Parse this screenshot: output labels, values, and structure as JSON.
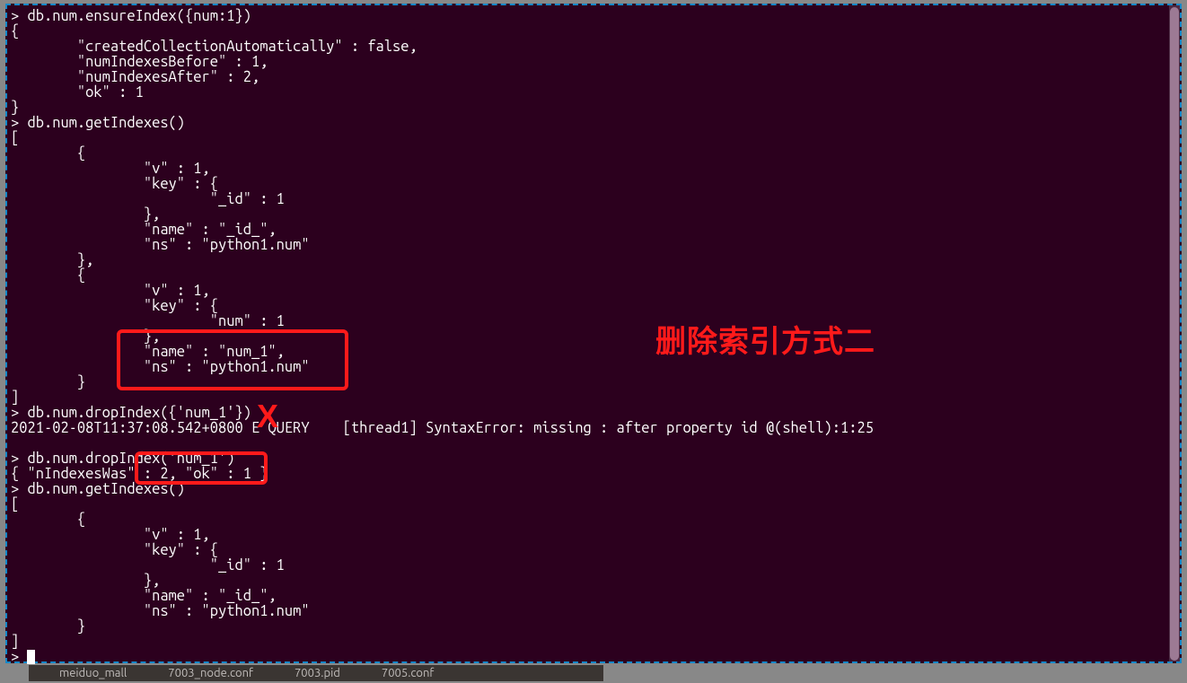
{
  "terminal": {
    "lines": [
      "> db.num.ensureIndex({num:1})",
      "{",
      "        \"createdCollectionAutomatically\" : false,",
      "        \"numIndexesBefore\" : 1,",
      "        \"numIndexesAfter\" : 2,",
      "        \"ok\" : 1",
      "}",
      "> db.num.getIndexes()",
      "[",
      "        {",
      "                \"v\" : 1,",
      "                \"key\" : {",
      "                        \"_id\" : 1",
      "                },",
      "                \"name\" : \"_id_\",",
      "                \"ns\" : \"python1.num\"",
      "        },",
      "        {",
      "                \"v\" : 1,",
      "                \"key\" : {",
      "                        \"num\" : 1",
      "                },",
      "                \"name\" : \"num_1\",",
      "                \"ns\" : \"python1.num\"",
      "        }",
      "]",
      "> db.num.dropIndex({'num_1'})",
      "2021-02-08T11:37:08.542+0800 E QUERY    [thread1] SyntaxError: missing : after property id @(shell):1:25",
      "",
      "> db.num.dropIndex('num_1')",
      "{ \"nIndexesWas\" : 2, \"ok\" : 1 }",
      "> db.num.getIndexes()",
      "[",
      "        {",
      "                \"v\" : 1,",
      "                \"key\" : {",
      "                        \"_id\" : 1",
      "                },",
      "                \"name\" : \"_id_\",",
      "                \"ns\" : \"python1.num\"",
      "        }",
      "]",
      "> "
    ]
  },
  "annotations": {
    "x_mark": "X",
    "big_label": "删除索引方式二"
  },
  "taskbar": {
    "item1": "meiduo_mall",
    "item2": "7003_node.conf",
    "item3": "7003.pid",
    "item4": "7005.conf"
  }
}
